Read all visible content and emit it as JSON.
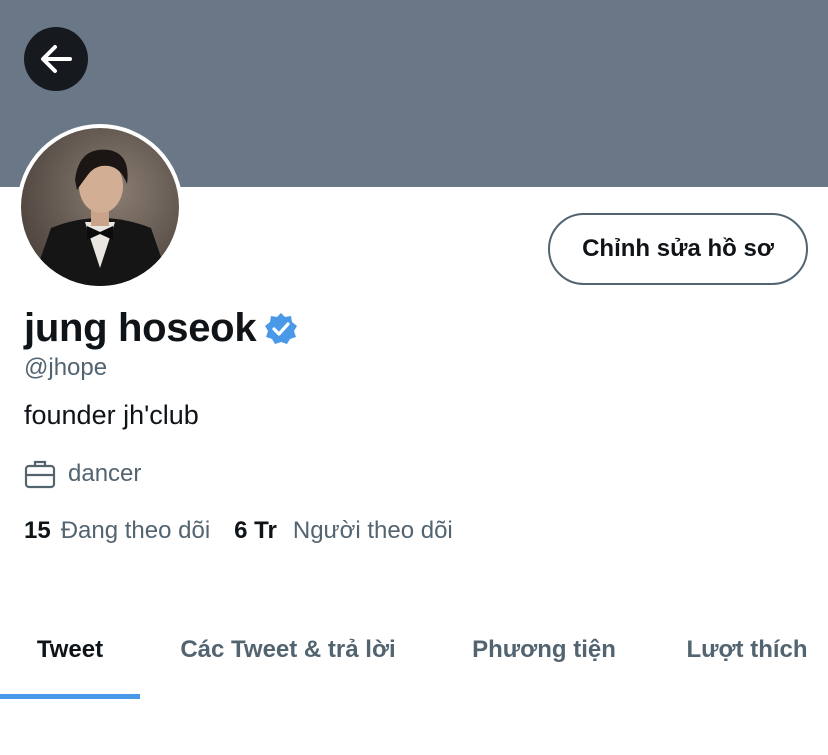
{
  "header": {
    "back_icon": "arrow-left-icon"
  },
  "profile": {
    "avatar_alt": "profile photo",
    "edit_button": "Chỉnh sửa hồ sơ",
    "name": "jung hoseok",
    "verified_icon": "verified-badge-icon",
    "handle": "@jhope",
    "bio": "founder jh'club",
    "job_icon": "briefcase-icon",
    "job": "dancer"
  },
  "stats": {
    "following_count": "15",
    "following_label": "Đang theo dõi",
    "followers_count": "6 Tr",
    "followers_label": "Người theo dõi"
  },
  "tabs": [
    {
      "label": "Tweet",
      "active": true
    },
    {
      "label": "Các Tweet & trả lời",
      "active": false
    },
    {
      "label": "Phương tiện",
      "active": false
    },
    {
      "label": "Lượt thích",
      "active": false
    }
  ],
  "colors": {
    "banner": "#697786",
    "accent": "#4a99e9",
    "verified": "#4a99e9",
    "secondary_text": "#536471"
  }
}
